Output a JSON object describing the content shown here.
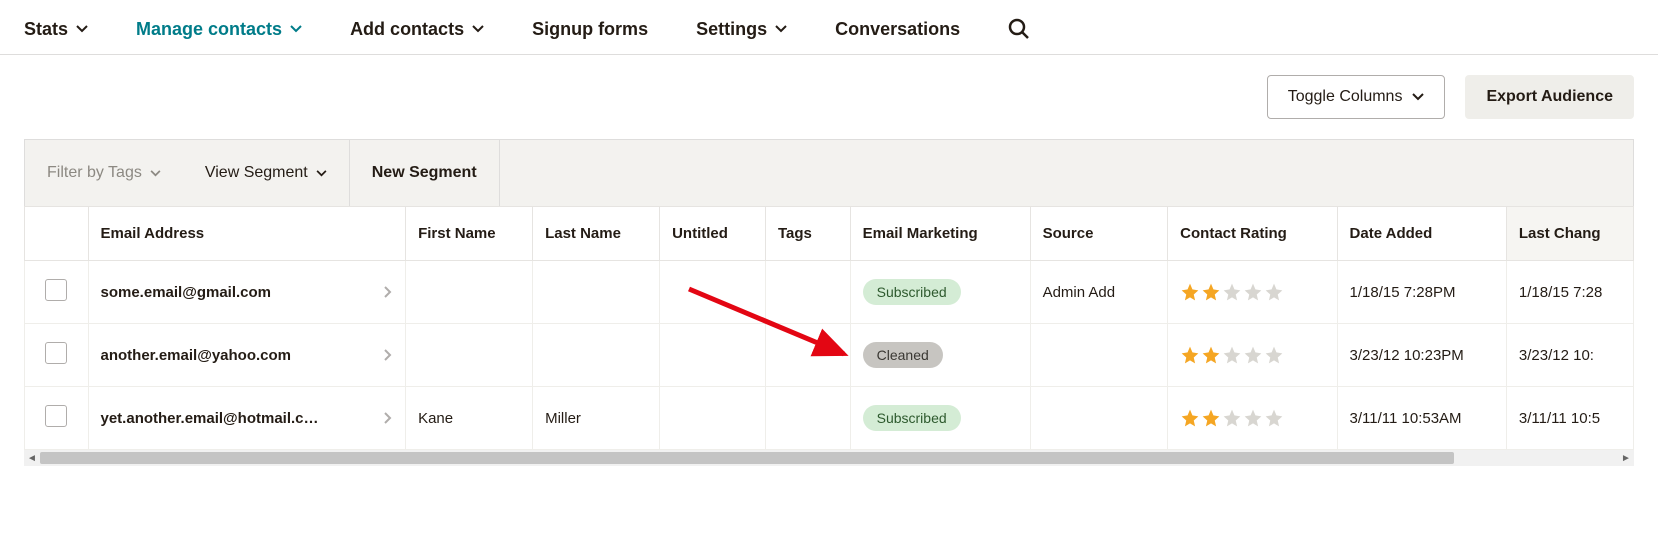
{
  "nav": {
    "stats": "Stats",
    "manage": "Manage contacts",
    "add": "Add contacts",
    "signup": "Signup forms",
    "settings": "Settings",
    "conversations": "Conversations"
  },
  "actions": {
    "toggle_columns": "Toggle Columns",
    "export_audience": "Export Audience"
  },
  "filters": {
    "filter_by_tags": "Filter by Tags",
    "view_segment": "View Segment",
    "new_segment": "New Segment"
  },
  "columns": {
    "email": "Email Address",
    "first_name": "First Name",
    "last_name": "Last Name",
    "untitled": "Untitled",
    "tags": "Tags",
    "marketing": "Email Marketing",
    "source": "Source",
    "rating": "Contact Rating",
    "date_added": "Date Added",
    "last_changed": "Last Chang"
  },
  "rows": [
    {
      "email": "some.email@gmail.com",
      "first_name": "",
      "last_name": "",
      "untitled": "",
      "tags": "",
      "marketing": "Subscribed",
      "marketing_style": "green",
      "source": "Admin Add",
      "rating": 2,
      "date_added": "1/18/15 7:28PM",
      "last_changed": "1/18/15 7:28"
    },
    {
      "email": "another.email@yahoo.com",
      "first_name": "",
      "last_name": "",
      "untitled": "",
      "tags": "",
      "marketing": "Cleaned",
      "marketing_style": "gray",
      "source": "",
      "rating": 2,
      "date_added": "3/23/12 10:23PM",
      "last_changed": "3/23/12 10:"
    },
    {
      "email": "yet.another.email@hotmail.c…",
      "first_name": "Kane",
      "last_name": "Miller",
      "untitled": "",
      "tags": "",
      "marketing": "Subscribed",
      "marketing_style": "green",
      "source": "",
      "rating": 2,
      "date_added": "3/11/11 10:53AM",
      "last_changed": "3/11/11 10:5"
    }
  ]
}
